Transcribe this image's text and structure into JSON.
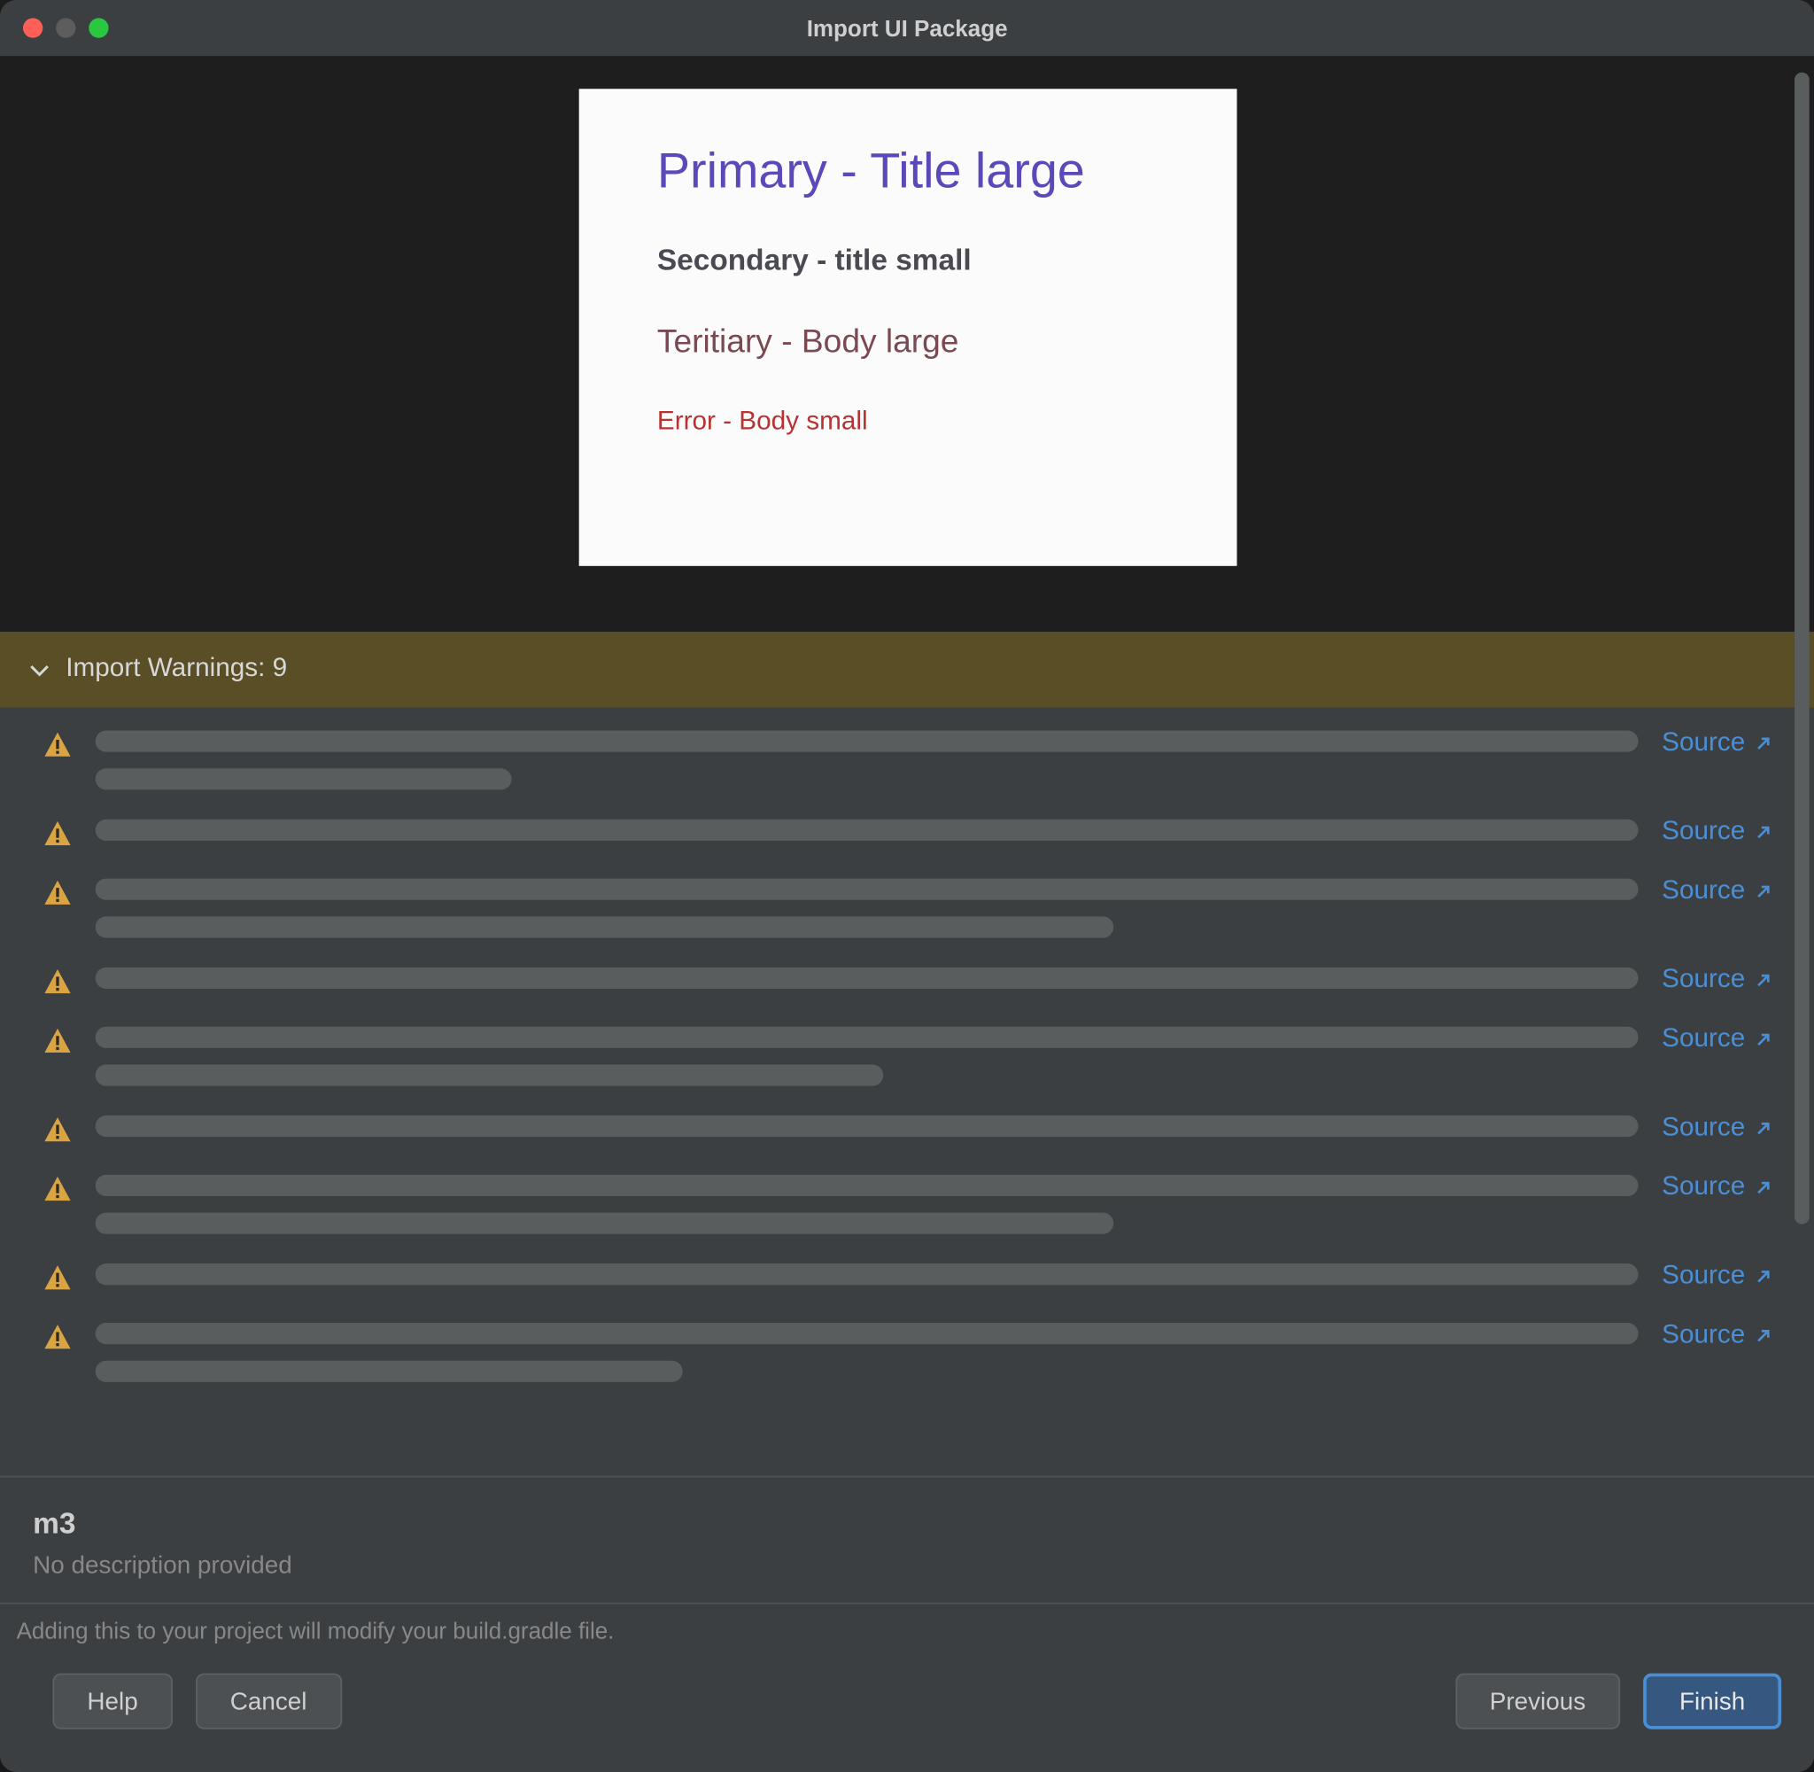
{
  "titlebar": {
    "title": "Import UI Package"
  },
  "preview": {
    "primary": "Primary - Title large",
    "secondary": "Secondary - title small",
    "tertiary": "Teritiary - Body large",
    "error": "Error - Body small"
  },
  "warnings": {
    "header_label": "Import Warnings: 9",
    "source_label": "Source",
    "rows": [
      {
        "line_widths": [
          100,
          27
        ]
      },
      {
        "line_widths": [
          100
        ]
      },
      {
        "line_widths": [
          100,
          66
        ]
      },
      {
        "line_widths": [
          100
        ]
      },
      {
        "line_widths": [
          100,
          51
        ]
      },
      {
        "line_widths": [
          100
        ]
      },
      {
        "line_widths": [
          100,
          66
        ]
      },
      {
        "line_widths": [
          100
        ]
      },
      {
        "line_widths": [
          100,
          38
        ]
      }
    ]
  },
  "meta": {
    "title": "m3",
    "description": "No description provided"
  },
  "footer": {
    "gradle_note": "Adding this to your project will modify your build.gradle file.",
    "help": "Help",
    "cancel": "Cancel",
    "previous": "Previous",
    "finish": "Finish"
  }
}
